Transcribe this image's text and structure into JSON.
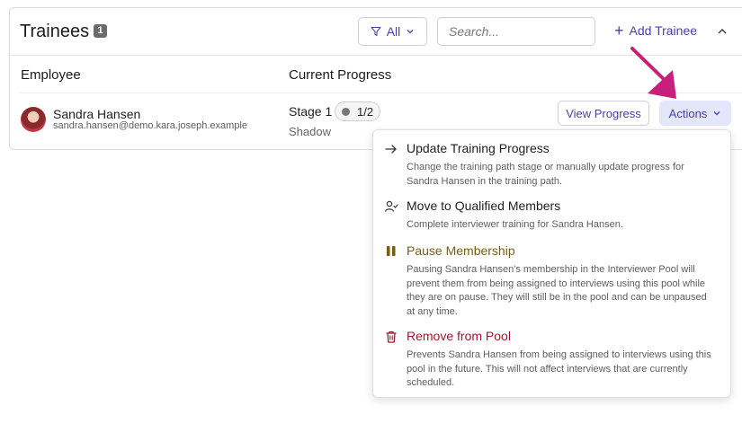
{
  "header": {
    "title": "Trainees",
    "count": "1",
    "filter_label": "All",
    "search_placeholder": "Search...",
    "add_label": "Add Trainee"
  },
  "columns": {
    "employee": "Employee",
    "progress": "Current Progress"
  },
  "rows": [
    {
      "name": "Sandra Hansen",
      "email": "sandra.hansen@demo.kara.joseph.example",
      "stage": "Stage 1",
      "stage_progress": "1/2",
      "sub_stage": "Shadow",
      "view_label": "View Progress",
      "actions_label": "Actions"
    }
  ],
  "menu": {
    "items": [
      {
        "label": "Update Training Progress",
        "description": "Change the training path stage or manually update progress for Sandra Hansen in the training path.",
        "icon": "arrow-right-icon"
      },
      {
        "label": "Move to Qualified Members",
        "description": "Complete interviewer training for Sandra Hansen.",
        "icon": "user-check-icon"
      },
      {
        "label": "Pause Membership",
        "description": "Pausing Sandra Hansen's membership in the Interviewer Pool will prevent them from being assigned to interviews using this pool while they are on pause. They will still be in the pool and can be unpaused at any time.",
        "icon": "pause-icon"
      },
      {
        "label": "Remove from Pool",
        "description": "Prevents Sandra Hansen from being assigned to interviews using this pool in the future. This will not affect interviews that are currently scheduled.",
        "icon": "trash-icon"
      }
    ]
  },
  "colors": {
    "accent": "#4b3fa8",
    "annotation_arrow": "#c8207a",
    "warning": "#7a5d10",
    "danger": "#a3162a"
  }
}
